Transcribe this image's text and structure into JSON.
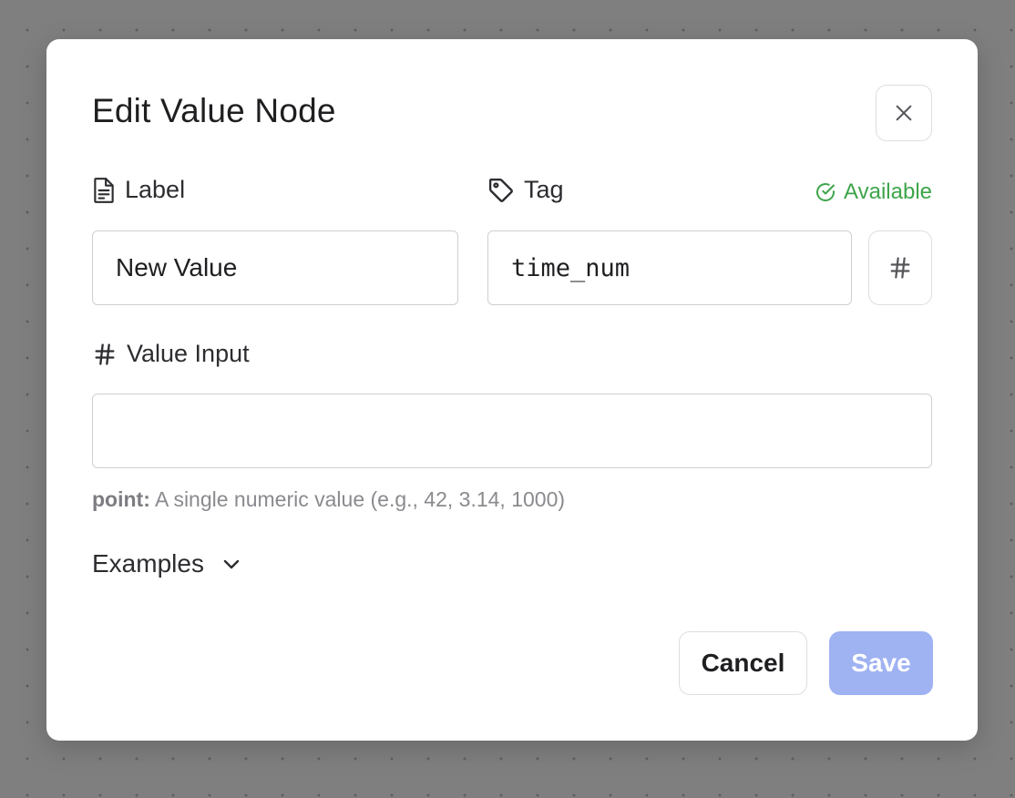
{
  "modal": {
    "title": "Edit Value Node",
    "close_icon": "close-icon"
  },
  "fields": {
    "label": {
      "title": "Label",
      "icon": "document-icon",
      "value": "New Value"
    },
    "tag": {
      "title": "Tag",
      "icon": "tag-icon",
      "value": "time_num",
      "status": "Available",
      "status_icon": "check-circle-icon",
      "status_color": "#3da54a",
      "type_button_icon": "hash-icon"
    },
    "value_input": {
      "title": "Value Input",
      "icon": "hash-icon",
      "value": "",
      "hint_term": "point:",
      "hint_text": " A single numeric value (e.g., 42, 3.14, 1000)"
    }
  },
  "examples": {
    "label": "Examples",
    "icon": "chevron-down-icon"
  },
  "footer": {
    "cancel_label": "Cancel",
    "save_label": "Save",
    "save_color": "#9fb2f2"
  }
}
